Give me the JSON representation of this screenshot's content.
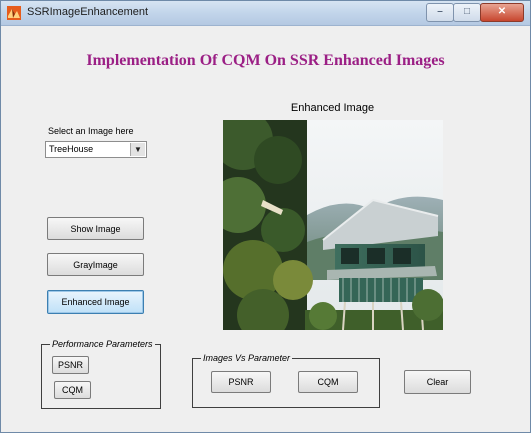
{
  "window": {
    "title": "SSRImageEnhancement"
  },
  "heading": "Implementation Of CQM On SSR Enhanced Images",
  "image_caption": "Enhanced Image",
  "select": {
    "label": "Select an Image here",
    "value": "TreeHouse"
  },
  "buttons": {
    "show_image": "Show Image",
    "gray_image": "GrayImage",
    "enhanced_image": "Enhanced Image",
    "psnr": "PSNR",
    "cqm": "CQM",
    "clear": "Clear"
  },
  "panels": {
    "performance": {
      "title": "Performance Parameters",
      "psnr": "PSNR",
      "cqm": "CQM"
    },
    "images_vs": {
      "title": "Images Vs Parameter"
    }
  },
  "colors": {
    "heading": "#9b1f85",
    "window_bg": "#efefef",
    "titlebar": "#c2d5ea"
  },
  "icons": [
    "matlab-app-icon",
    "minimize-icon",
    "maximize-icon",
    "close-icon",
    "chevron-down-icon"
  ]
}
